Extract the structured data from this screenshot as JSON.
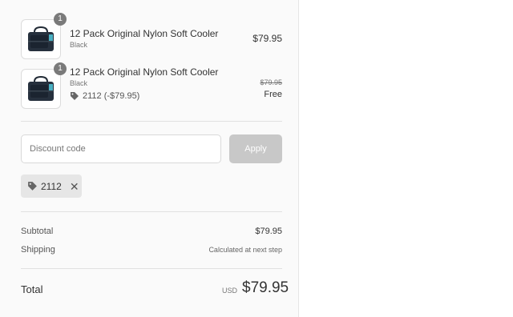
{
  "line_items": [
    {
      "quantity": "1",
      "name": "12 Pack Original Nylon Soft Cooler",
      "variant": "Black",
      "price": "$79.95"
    },
    {
      "quantity": "1",
      "name": "12 Pack Original Nylon Soft Cooler",
      "variant": "Black",
      "discount_label": "2112 (-$79.95)",
      "original_price": "$79.95",
      "price": "Free"
    }
  ],
  "discount": {
    "placeholder": "Discount code",
    "apply_label": "Apply"
  },
  "applied_code": {
    "code": "2112",
    "remove_symbol": "✕"
  },
  "summary": {
    "subtotal_label": "Subtotal",
    "subtotal_value": "$79.95",
    "shipping_label": "Shipping",
    "shipping_value": "Calculated at next step"
  },
  "total": {
    "label": "Total",
    "currency": "USD",
    "amount": "$79.95"
  },
  "icons": {
    "tag": "tag-icon",
    "product": "cooler-bag-image"
  }
}
